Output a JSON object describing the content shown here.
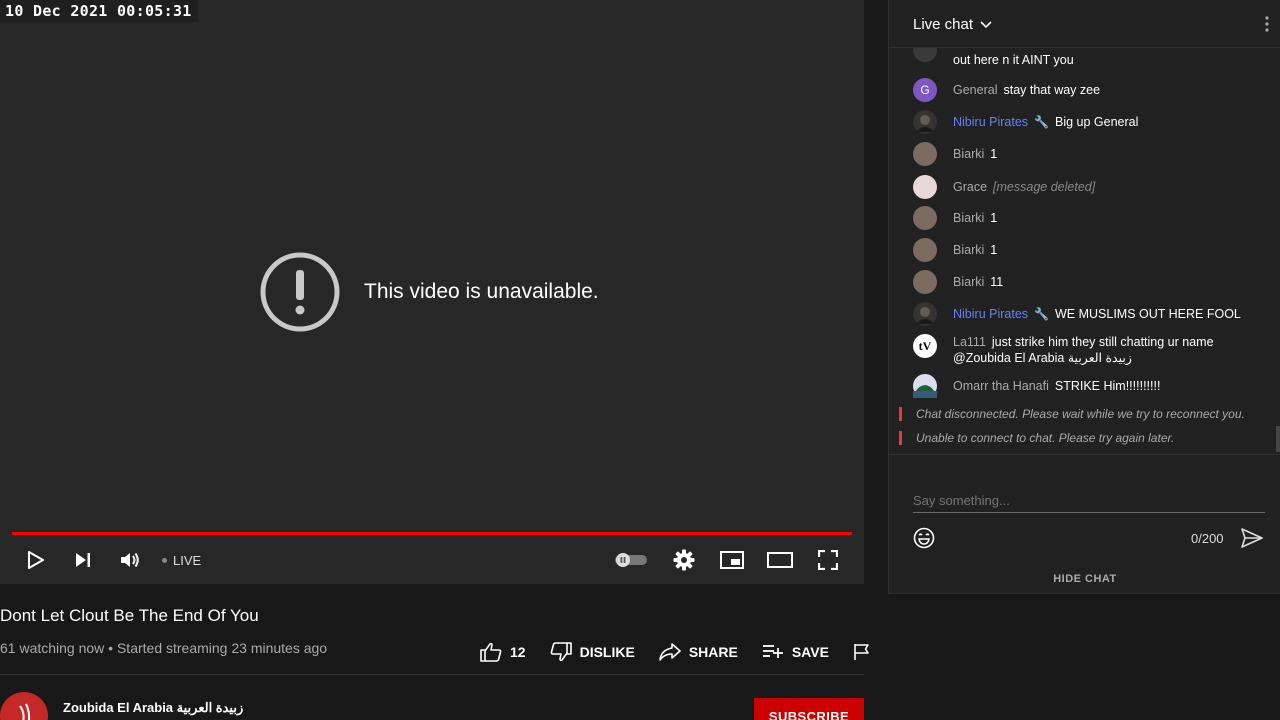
{
  "overlay": {
    "timestamp": "10 Dec 2021 00:05:31"
  },
  "player": {
    "error_message": "This video is unavailable.",
    "live_label": "LIVE",
    "progress": 1.0,
    "accent_color": "#ff0000"
  },
  "video": {
    "title": "Dont Let Clout Be The End Of You",
    "meta": "61 watching now • Started streaming 23 minutes ago",
    "actions": {
      "like_count": "12",
      "dislike_label": "DISLIKE",
      "share_label": "SHARE",
      "save_label": "SAVE"
    }
  },
  "channel": {
    "name": "Zoubida El Arabia زبيدة العربية",
    "subscribe_label": "SUBSCRIBE"
  },
  "chat": {
    "title": "Live chat",
    "partial_message": "out here n it AINT you",
    "messages": [
      {
        "author": "General",
        "text": "stay that way zee",
        "avatar_letter": "G",
        "avatar_color": "#7e57c2"
      },
      {
        "author": "Nibiru Pirates",
        "text": "Big up General",
        "moderator": true
      },
      {
        "author": "Biarki",
        "text": "1"
      },
      {
        "author": "Grace",
        "text": "[message deleted]",
        "deleted": true
      },
      {
        "author": "Biarki",
        "text": "1"
      },
      {
        "author": "Biarki",
        "text": "1"
      },
      {
        "author": "Biarki",
        "text": "11"
      },
      {
        "author": "Nibiru Pirates",
        "text": "WE MUSLIMS OUT HERE FOOL",
        "moderator": true
      },
      {
        "author": "La111",
        "text": "just strike him they still chatting ur name",
        "text_line2": "@Zoubida El Arabia زبيدة العربية"
      },
      {
        "author": "Omarr tha Hanafi",
        "text": "STRIKE Him!!!!!!!!!!"
      }
    ],
    "system_messages": [
      "Chat disconnected. Please wait while we try to reconnect you.",
      "Unable to connect to chat. Please try again later."
    ],
    "input_placeholder": "Say something...",
    "char_counter": "0/200",
    "hide_chat_label": "HIDE CHAT"
  }
}
